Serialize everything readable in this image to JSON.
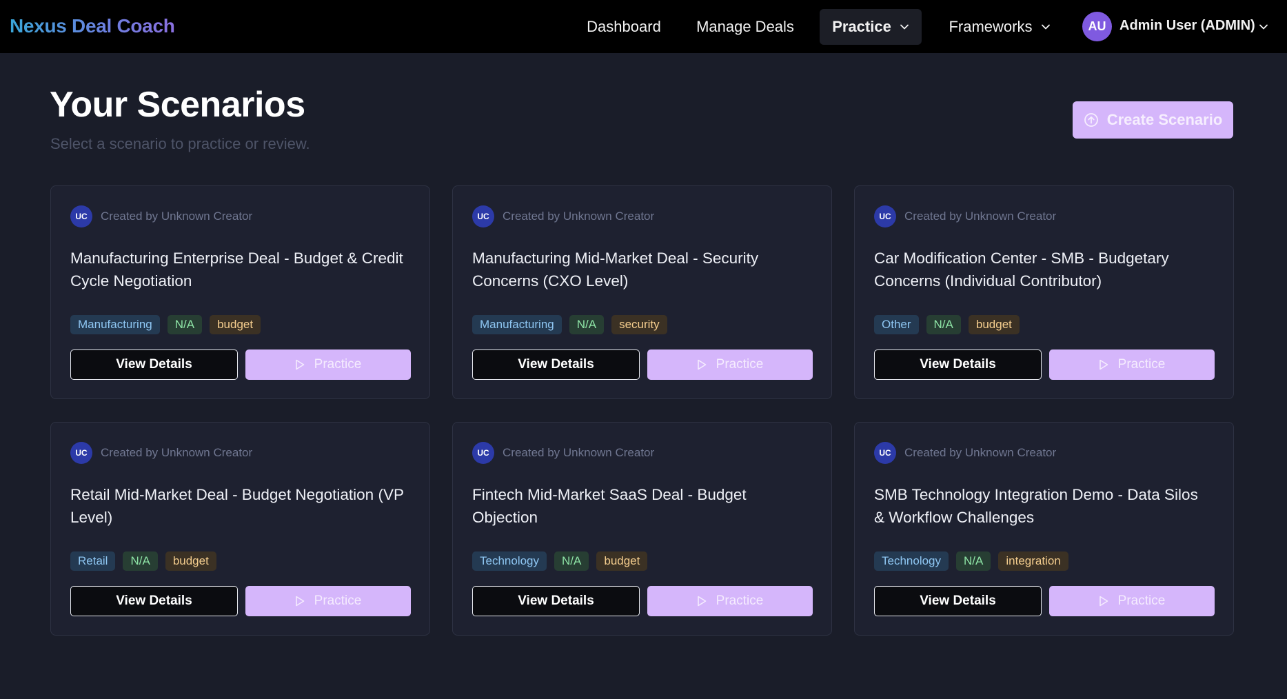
{
  "header": {
    "brand": "Nexus Deal Coach",
    "nav": {
      "dashboard": "Dashboard",
      "manage_deals": "Manage Deals",
      "practice": "Practice",
      "frameworks": "Frameworks"
    },
    "user": {
      "initials": "AU",
      "name": "Admin User (ADMIN)"
    }
  },
  "page": {
    "title": "Your Scenarios",
    "subtitle": "Select a scenario to practice or review.",
    "create_button": "Create Scenario"
  },
  "card_labels": {
    "creator_initials": "UC",
    "view_details": "View Details",
    "practice": "Practice"
  },
  "scenarios": [
    {
      "creator": "Created by Unknown Creator",
      "title": "Manufacturing Enterprise Deal - Budget & Credit Cycle Negotiation",
      "industry": "Manufacturing",
      "status": "N/A",
      "topic": "budget"
    },
    {
      "creator": "Created by Unknown Creator",
      "title": "Manufacturing Mid-Market Deal - Security Concerns (CXO Level)",
      "industry": "Manufacturing",
      "status": "N/A",
      "topic": "security"
    },
    {
      "creator": "Created by Unknown Creator",
      "title": "Car Modification Center - SMB - Budgetary Concerns (Individual Contributor)",
      "industry": "Other",
      "status": "N/A",
      "topic": "budget"
    },
    {
      "creator": "Created by Unknown Creator",
      "title": "Retail Mid-Market Deal - Budget Negotiation (VP Level)",
      "industry": "Retail",
      "status": "N/A",
      "topic": "budget"
    },
    {
      "creator": "Created by Unknown Creator",
      "title": "Fintech Mid-Market SaaS Deal - Budget Objection",
      "industry": "Technology",
      "status": "N/A",
      "topic": "budget"
    },
    {
      "creator": "Created by Unknown Creator",
      "title": "SMB Technology Integration Demo - Data Silos & Workflow Challenges",
      "industry": "Technology",
      "status": "N/A",
      "topic": "integration"
    }
  ],
  "colors": {
    "background": "#1a1d29",
    "card": "#1e2130",
    "accent": "#d5b6fb",
    "avatar_user": "#7f5ae0",
    "avatar_creator": "#2c3aa8"
  },
  "icons": {
    "create": "arrow-up-circle-icon",
    "practice": "play-icon",
    "dropdown": "chevron-down-icon"
  }
}
